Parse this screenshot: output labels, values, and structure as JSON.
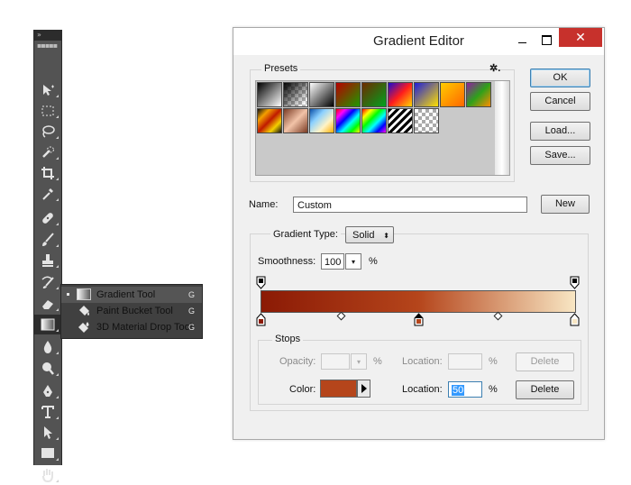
{
  "toolbar": {
    "grip": "»  ▪▪▪▪▪",
    "tools": [
      {
        "name": "move-tool"
      },
      {
        "name": "marquee-tool"
      },
      {
        "name": "lasso-tool"
      },
      {
        "name": "quick-selection-tool"
      },
      {
        "name": "crop-tool"
      },
      {
        "name": "eyedropper-tool"
      },
      {
        "name": "healing-brush-tool"
      },
      {
        "name": "brush-tool"
      },
      {
        "name": "clone-stamp-tool"
      },
      {
        "name": "history-brush-tool"
      },
      {
        "name": "eraser-tool"
      },
      {
        "name": "gradient-tool"
      },
      {
        "name": "blur-tool"
      },
      {
        "name": "dodge-tool"
      },
      {
        "name": "pen-tool"
      },
      {
        "name": "type-tool"
      },
      {
        "name": "path-selection-tool"
      },
      {
        "name": "rectangle-tool"
      },
      {
        "name": "hand-tool"
      }
    ]
  },
  "flyout": {
    "items": [
      {
        "label": "Gradient Tool",
        "key": "G",
        "icon": "gradient-icon"
      },
      {
        "label": "Paint Bucket Tool",
        "key": "G",
        "icon": "paint-bucket-icon"
      },
      {
        "label": "3D Material Drop Tool",
        "key": "G",
        "icon": "3d-material-drop-icon"
      }
    ]
  },
  "dialog": {
    "title": "Gradient Editor",
    "close_glyph": "✕",
    "presets_label": "Presets",
    "gear_glyph": "✲.",
    "ok": "OK",
    "cancel": "Cancel",
    "load": "Load...",
    "save": "Save...",
    "name_label": "Name:",
    "name_value": "Custom",
    "new": "New",
    "gradient_type_label": "Gradient Type:",
    "gradient_type_value": "Solid",
    "smoothness_label": "Smoothness:",
    "smoothness_value": "100",
    "smoothness_unit": "%",
    "stops_label": "Stops",
    "opacity_label": "Opacity:",
    "opacity_unit": "%",
    "opacity_location_label": "Location:",
    "opacity_location_unit": "%",
    "opacity_delete": "Delete",
    "color_label": "Color:",
    "color_location_label": "Location:",
    "color_location_value": "50",
    "color_location_unit": "%",
    "color_delete": "Delete"
  },
  "colors": {
    "stop_left": "#8b1a05",
    "stop_mid": "#b5451b",
    "stop_right": "#f8e6c3",
    "accent": "#3c7fb1"
  }
}
